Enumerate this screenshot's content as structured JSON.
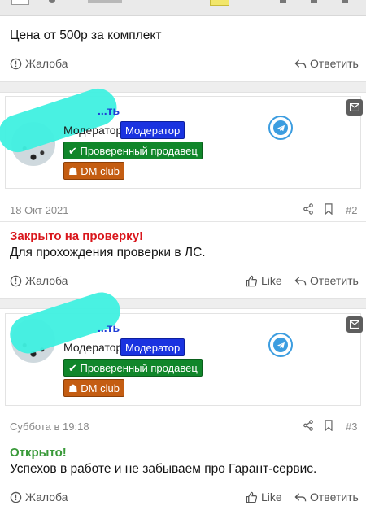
{
  "post_top": {
    "text": "Цена от 500р за комплект",
    "report": "Жалоба",
    "reply": "Ответить"
  },
  "post2": {
    "username": "...ть",
    "role": "Модератор",
    "badge_role": "Модератор",
    "badge_verified": "Проверенный продавец",
    "badge_club": "DM club",
    "date": "18 Окт 2021",
    "number": "#2",
    "status": "Закрыто на проверку!",
    "text": "Для прохождения проверки в ЛС.",
    "report": "Жалоба",
    "like": "Like",
    "reply": "Ответить"
  },
  "post3": {
    "username": "...ть",
    "role": "Модератор",
    "badge_role": "Модератор",
    "badge_verified": "Проверенный продавец",
    "badge_club": "DM club",
    "date": "Суббота в 19:18",
    "number": "#3",
    "status": "Открыто!",
    "text": "Успехов в работе и не забываем про Гарант-сервис.",
    "report": "Жалоба",
    "like": "Like",
    "reply": "Ответить"
  },
  "colors": {
    "moderator_badge": "#1a33e0",
    "verified_badge": "#10862a",
    "club_badge": "#c45d12",
    "closed_status": "#d9161c",
    "open_status": "#3a9a3a",
    "username": "#1f3dd6"
  }
}
